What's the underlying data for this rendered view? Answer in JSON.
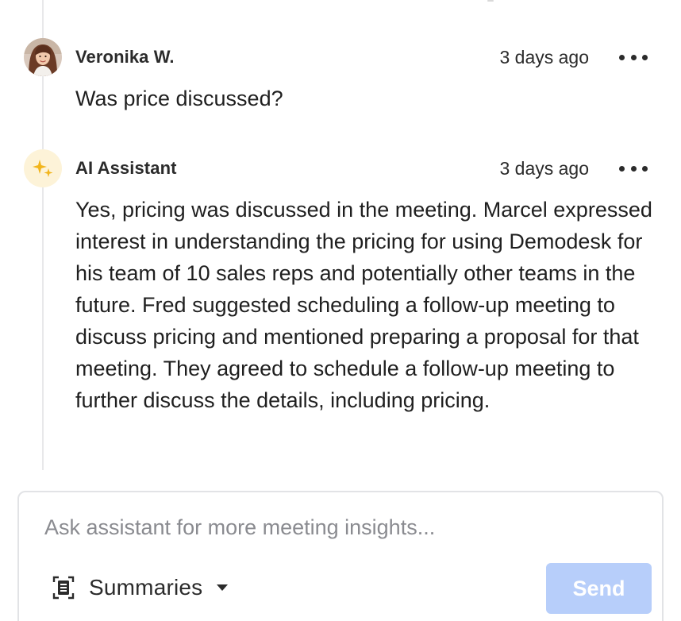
{
  "messages": [
    {
      "author": "Veronika W.",
      "time": "3 days ago",
      "avatar_icon": "user-photo-avatar",
      "text": "Was price discussed?"
    },
    {
      "author": "AI Assistant",
      "time": "3 days ago",
      "avatar_icon": "sparkles-icon",
      "text": "Yes, pricing was discussed in the meeting. Marcel expressed interest in understanding the pricing for using Demodesk for his team of 10 sales reps and potentially other teams in the future. Fred suggested scheduling a follow-up meeting to discuss pricing and mentioned preparing a proposal for that meeting. They agreed to schedule a follow-up meeting to further discuss the details, including pricing."
    }
  ],
  "composer": {
    "placeholder": "Ask assistant for more meeting insights...",
    "value": "",
    "mode_label": "Summaries",
    "mode_icon": "document-scan-icon",
    "send_label": "Send"
  },
  "colors": {
    "send_disabled": "#b7cefa",
    "ai_avatar_bg": "#fdf3d8",
    "sparkle": "#f2b51c",
    "placeholder": "#8a8b90"
  }
}
